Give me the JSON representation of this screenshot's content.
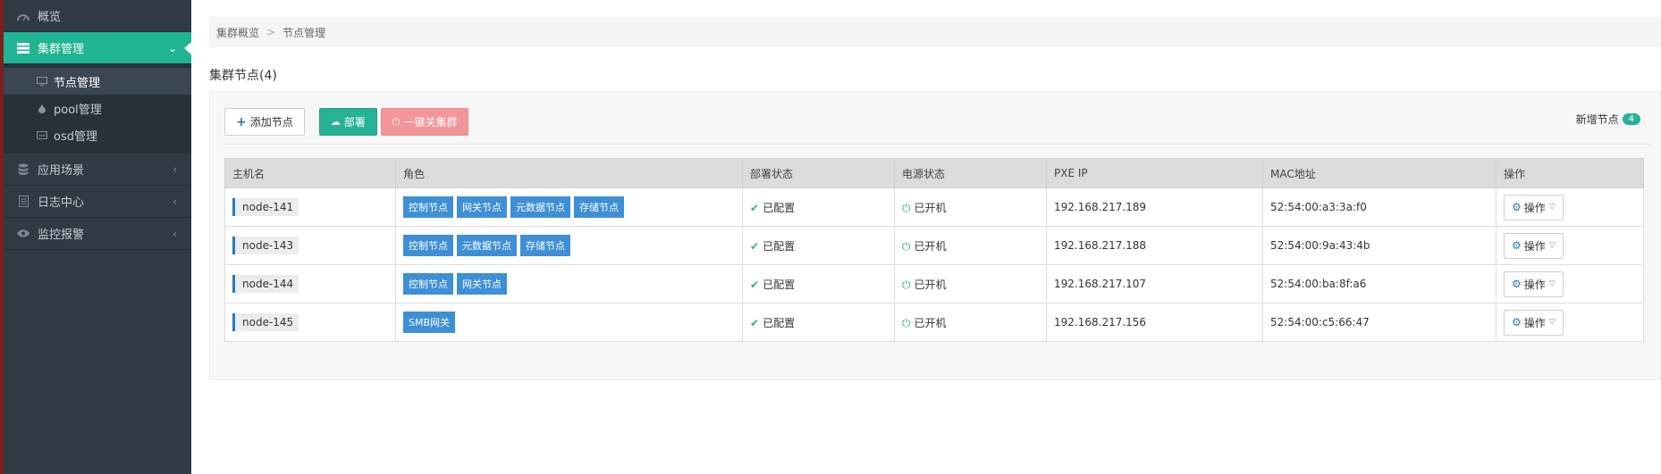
{
  "sidebar": {
    "items": [
      {
        "label": "概览",
        "icon": "dashboard-icon"
      },
      {
        "label": "集群管理",
        "icon": "server-icon",
        "active": true
      },
      {
        "label": "应用场景",
        "icon": "database-icon"
      },
      {
        "label": "日志中心",
        "icon": "log-icon"
      },
      {
        "label": "监控报警",
        "icon": "eye-icon"
      }
    ],
    "sub_items": [
      {
        "label": "节点管理",
        "icon": "monitor-icon",
        "current": true
      },
      {
        "label": "pool管理",
        "icon": "drop-icon"
      },
      {
        "label": "osd管理",
        "icon": "drive-icon"
      }
    ]
  },
  "breadcrumb": {
    "parent": "集群概览",
    "separator": ">",
    "current": "节点管理"
  },
  "page_title": "集群节点(4)",
  "toolbar": {
    "add_label": "添加节点",
    "deploy_label": "部署",
    "shutdown_label": "一键关集群",
    "new_nodes_label": "新增节点",
    "new_nodes_count": "4"
  },
  "table": {
    "headers": [
      "主机名",
      "角色",
      "部署状态",
      "电源状态",
      "PXE IP",
      "MAC地址",
      "操作"
    ],
    "rows": [
      {
        "host": "node-141",
        "roles": [
          "控制节点",
          "网关节点",
          "元数据节点",
          "存储节点"
        ],
        "deploy": "已配置",
        "power": "已开机",
        "ip": "192.168.217.189",
        "mac": "52:54:00:a3:3a:f0",
        "op": "操作"
      },
      {
        "host": "node-143",
        "roles": [
          "控制节点",
          "元数据节点",
          "存储节点"
        ],
        "deploy": "已配置",
        "power": "已开机",
        "ip": "192.168.217.188",
        "mac": "52:54:00:9a:43:4b",
        "op": "操作"
      },
      {
        "host": "node-144",
        "roles": [
          "控制节点",
          "网关节点"
        ],
        "deploy": "已配置",
        "power": "已开机",
        "ip": "192.168.217.107",
        "mac": "52:54:00:ba:8f:a6",
        "op": "操作"
      },
      {
        "host": "node-145",
        "roles": [
          "SMB网关"
        ],
        "deploy": "已配置",
        "power": "已开机",
        "ip": "192.168.217.156",
        "mac": "52:54:00:c5:66:47",
        "op": "操作"
      }
    ]
  },
  "colors": {
    "accent": "#1fb493",
    "sidebar": "#2f3a45",
    "role_tag": "#3e8fd6",
    "danger_btn": "#f39599"
  }
}
